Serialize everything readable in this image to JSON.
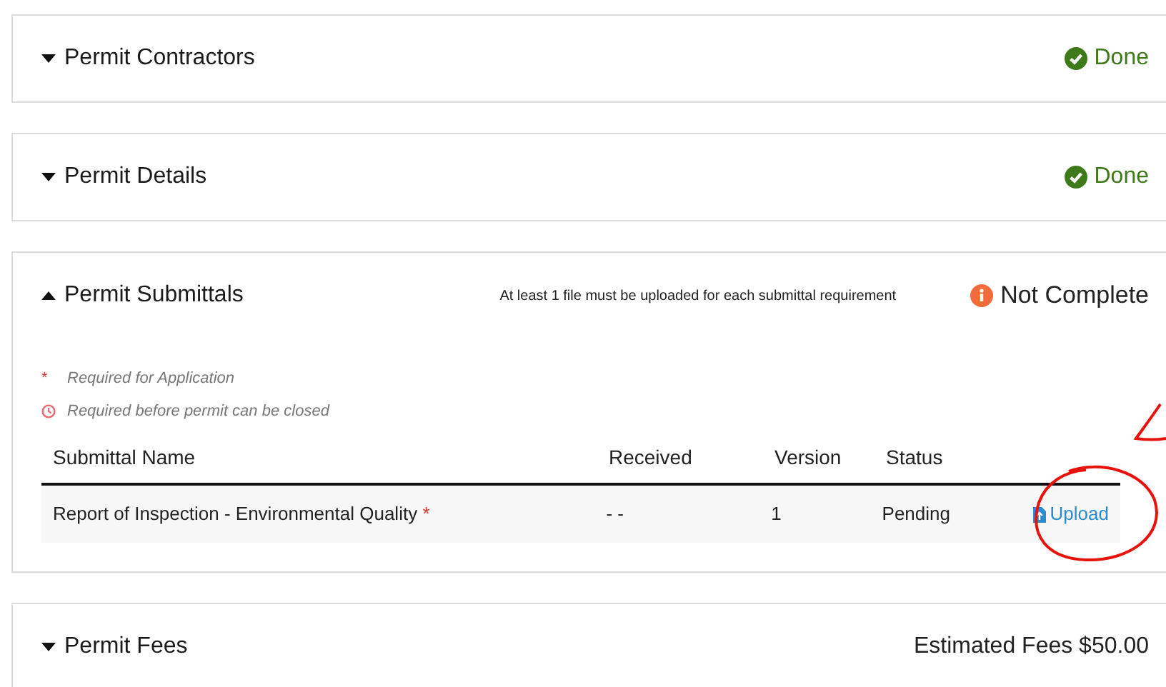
{
  "sections": [
    {
      "kind": "status",
      "title": "Permit Contractors",
      "expanded": false,
      "status": {
        "kind": "done",
        "label": "Done"
      }
    },
    {
      "kind": "status",
      "title": "Permit Details",
      "expanded": false,
      "status": {
        "kind": "done",
        "label": "Done"
      }
    },
    {
      "kind": "submittals",
      "title": "Permit Submittals",
      "expanded": true,
      "note": "At least 1 file must be uploaded for each submittal requirement",
      "status": {
        "kind": "incomplete",
        "label": "Not Complete"
      },
      "legend": [
        {
          "kind": "asterisk",
          "symbol": "*",
          "text": "Required for Application"
        },
        {
          "kind": "clock",
          "text": "Required before permit can be closed"
        }
      ],
      "table": {
        "columns": [
          "Submittal Name",
          "Received",
          "Version",
          "Status"
        ],
        "rows": [
          {
            "name": "Report of Inspection - Environmental Quality",
            "required_mark": "*",
            "received": "- -",
            "version": "1",
            "status": "Pending",
            "action": "Upload"
          }
        ]
      }
    },
    {
      "kind": "fees",
      "title": "Permit Fees",
      "expanded": false,
      "summary": "Estimated Fees $50.00"
    }
  ]
}
